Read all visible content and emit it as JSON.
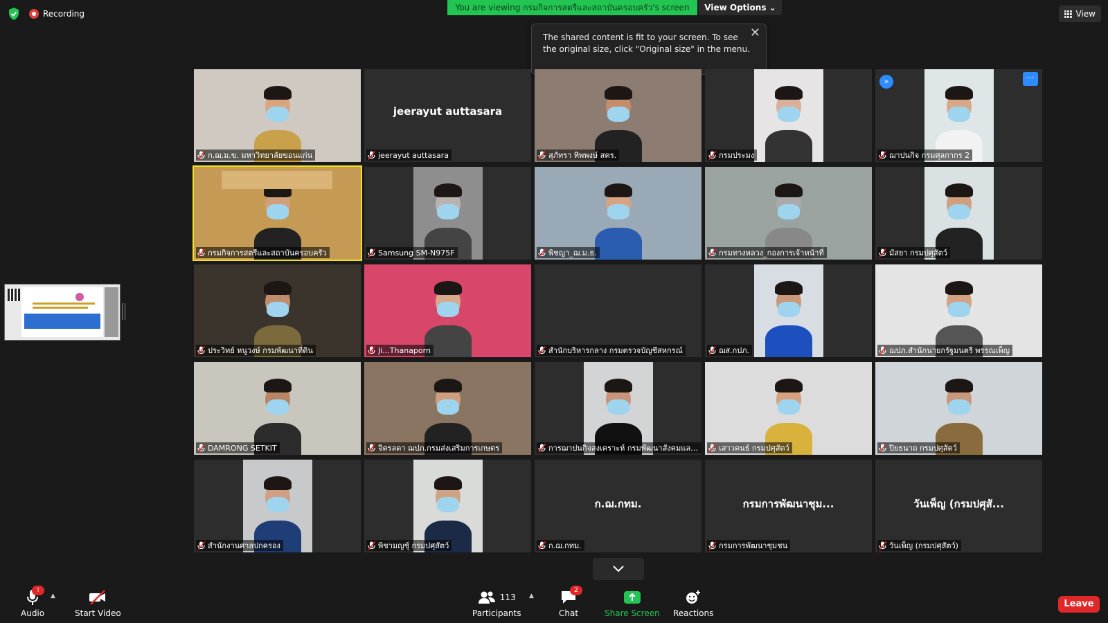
{
  "recording_label": "Recording",
  "banner": {
    "text": "You are viewing กรมกิจการสตรีและสถาบันครอบครัว's screen"
  },
  "view_options_label": "View Options ⌄",
  "view_label": "View",
  "tooltip": {
    "text": "The shared content is fit to your screen. To see the original size, click \"Original size\" in the menu.",
    "close": "✕"
  },
  "participants_tiles": [
    {
      "name": "ก.ฌ.ม.ข. มหาวิทยาลัยขอนแก่น",
      "video": true,
      "bg": "#cfc9c2",
      "skin": "#d8a57e",
      "shirt": "#c8a14a"
    },
    {
      "name": "jeerayut auttasara",
      "video": false,
      "display": "jeerayut auttasara"
    },
    {
      "name": "สุภัทรา ทิพพงษ์ สคร.",
      "video": true,
      "bg": "#8c7c72",
      "skin": "#c58d6a",
      "shirt": "#222"
    },
    {
      "name": "กรมประมง",
      "video": true,
      "bg": "#e7e4e6",
      "skin": "#d9b09a",
      "shirt": "#333"
    },
    {
      "name": "ฌาปนกิจ กรมศุลกากร 2",
      "video": true,
      "bg": "#dfe6e8",
      "skin": "#d7a888",
      "shirt": "#f2f2f2"
    },
    {
      "name": "กรมกิจการสตรีและสถาบันครอบครัว",
      "video": true,
      "active": true,
      "bg": "#c49a55",
      "skin": "#d1a07a",
      "shirt": "#222"
    },
    {
      "name": "Samsung SM-N975F",
      "video": true,
      "bg": "#8e8e8e",
      "skin": "#b9b3ad",
      "shirt": "#444"
    },
    {
      "name": "พิชญา_ฌ.ม.ธ.",
      "video": true,
      "bg": "#99a9b5",
      "skin": "#d6a482",
      "shirt": "#2a5db0"
    },
    {
      "name": "กรมทางหลวง_กองการเจ้าหน้าที่",
      "video": true,
      "bg": "#9aa3a0",
      "skin": "#aaaaaa",
      "shirt": "#888"
    },
    {
      "name": "มัสยา กรมปศุสัตว์",
      "video": true,
      "bg": "#d9e1e3",
      "skin": "#cf9f7e",
      "shirt": "#222"
    },
    {
      "name": "ประวิทย์ หนูวงษ์ กรมพัฒนาที่ดิน",
      "video": true,
      "bg": "#3b342c",
      "skin": "#c08d6c",
      "shirt": "#7b6a3c"
    },
    {
      "name": "Ji...Thanaporn",
      "video": true,
      "bg": "#d8466a",
      "skin": "#d8a98c",
      "shirt": "#444"
    },
    {
      "name": "สำนักบริหารกลาง กรมตรวจบัญชีสหกรณ์",
      "video": false,
      "display": ""
    },
    {
      "name": "ฌส.กปภ.",
      "video": true,
      "bg": "#d7dde2",
      "skin": "#c99a7a",
      "shirt": "#1e4fbf"
    },
    {
      "name": "ฌปภ.สำนักนายกรัฐมนตรี พรรณเพ็ญ",
      "video": true,
      "bg": "#e4e4e4",
      "skin": "#d3a283",
      "shirt": "#555"
    },
    {
      "name": "DAMRONG SETKIT",
      "video": true,
      "bg": "#c9c6bd",
      "skin": "#b98461",
      "shirt": "#2c2c2c"
    },
    {
      "name": "จิตรลดา ฌปภ.กรมส่งเสริมการเกษตร",
      "video": true,
      "bg": "#8a7562",
      "skin": "#cf9e80",
      "shirt": "#222"
    },
    {
      "name": "การฌาปนกิจสงเคราะห์ กรมพัฒนาสังคมและสวัสดิการ",
      "video": true,
      "bg": "#d2d4d6",
      "skin": "#c8957a",
      "shirt": "#111"
    },
    {
      "name": "เสาวคนธ์ กรมปศุสัตว์",
      "video": true,
      "bg": "#dcdcdc",
      "skin": "#d4a27d",
      "shirt": "#d8b23d"
    },
    {
      "name": "ปิยธนาถ กรมปศุสัตว์",
      "video": true,
      "bg": "#cfd5d9",
      "skin": "#c9987a",
      "shirt": "#8a6b3d"
    },
    {
      "name": "สำนักงานศาลปกครอง",
      "video": true,
      "bg": "#c7c9cb",
      "skin": "#cfa084",
      "shirt": "#1f3e77"
    },
    {
      "name": "พิชามญชุ์ กรมปศุสัตว์",
      "video": true,
      "bg": "#d8dbd8",
      "skin": "#d1a385",
      "shirt": "#1b2a46"
    },
    {
      "name": "ก.ฌ.กทม.",
      "video": false,
      "display": "ก.ฌ.กทม."
    },
    {
      "name": "กรมการพัฒนาชุมชน",
      "video": false,
      "display": "กรมการพัฒนาชุม..."
    },
    {
      "name": "วันเพ็ญ (กรมปศุสัตว์)",
      "video": false,
      "display": "วันเพ็ญ (กรมปศุสั..."
    }
  ],
  "toolbar": {
    "audio": "Audio",
    "audio_alert": "!",
    "start_video": "Start Video",
    "participants_count": "113",
    "participants": "Participants",
    "chat": "Chat",
    "chat_badge": "2",
    "share_screen": "Share Screen",
    "reactions": "Reactions",
    "leave": "Leave"
  },
  "colors": {
    "accent_green": "#23c552",
    "leave_red": "#e02828",
    "active_speaker": "#f3e21b",
    "link_blue": "#2d8cff"
  }
}
